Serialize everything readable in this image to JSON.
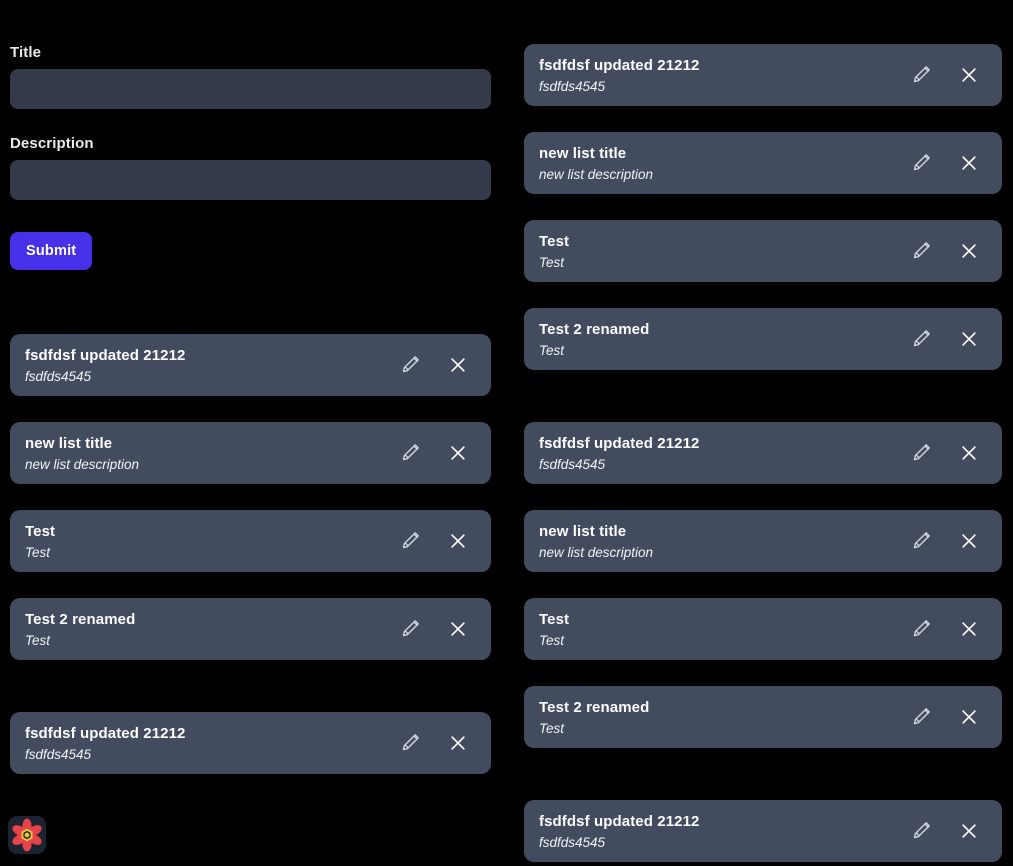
{
  "theme": {
    "page_background": "#000000",
    "card_background": "#434c5f",
    "input_background": "#353a4a",
    "accent_button": "#4630e8",
    "text_primary": "#ffffff",
    "logo_petal_color": "#e8424a",
    "logo_center_color": "#e8c93a"
  },
  "form": {
    "title_label": "Title",
    "title_value": "",
    "title_placeholder": "",
    "description_label": "Description",
    "description_value": "",
    "description_placeholder": "",
    "submit_label": "Submit"
  },
  "icons": {
    "edit": "pencil-icon",
    "delete": "close-x-icon",
    "logo": "atom-flower-logo-icon"
  },
  "lists": {
    "right_top": [
      {
        "title": "fsdfdsf updated 21212",
        "description": "fsdfds4545"
      },
      {
        "title": "new list title",
        "description": "new list description"
      },
      {
        "title": "Test",
        "description": "Test"
      },
      {
        "title": "Test 2 renamed",
        "description": "Test"
      }
    ],
    "left_middle": [
      {
        "title": "fsdfdsf updated 21212",
        "description": "fsdfds4545"
      },
      {
        "title": "new list title",
        "description": "new list description"
      },
      {
        "title": "Test",
        "description": "Test"
      },
      {
        "title": "Test 2 renamed",
        "description": "Test"
      }
    ],
    "right_middle": [
      {
        "title": "fsdfdsf updated 21212",
        "description": "fsdfds4545"
      },
      {
        "title": "new list title",
        "description": "new list description"
      },
      {
        "title": "Test",
        "description": "Test"
      },
      {
        "title": "Test 2 renamed",
        "description": "Test"
      }
    ],
    "left_bottom": [
      {
        "title": "fsdfdsf updated 21212",
        "description": "fsdfds4545"
      }
    ],
    "right_bottom": [
      {
        "title": "fsdfdsf updated 21212",
        "description": "fsdfds4545"
      }
    ]
  }
}
